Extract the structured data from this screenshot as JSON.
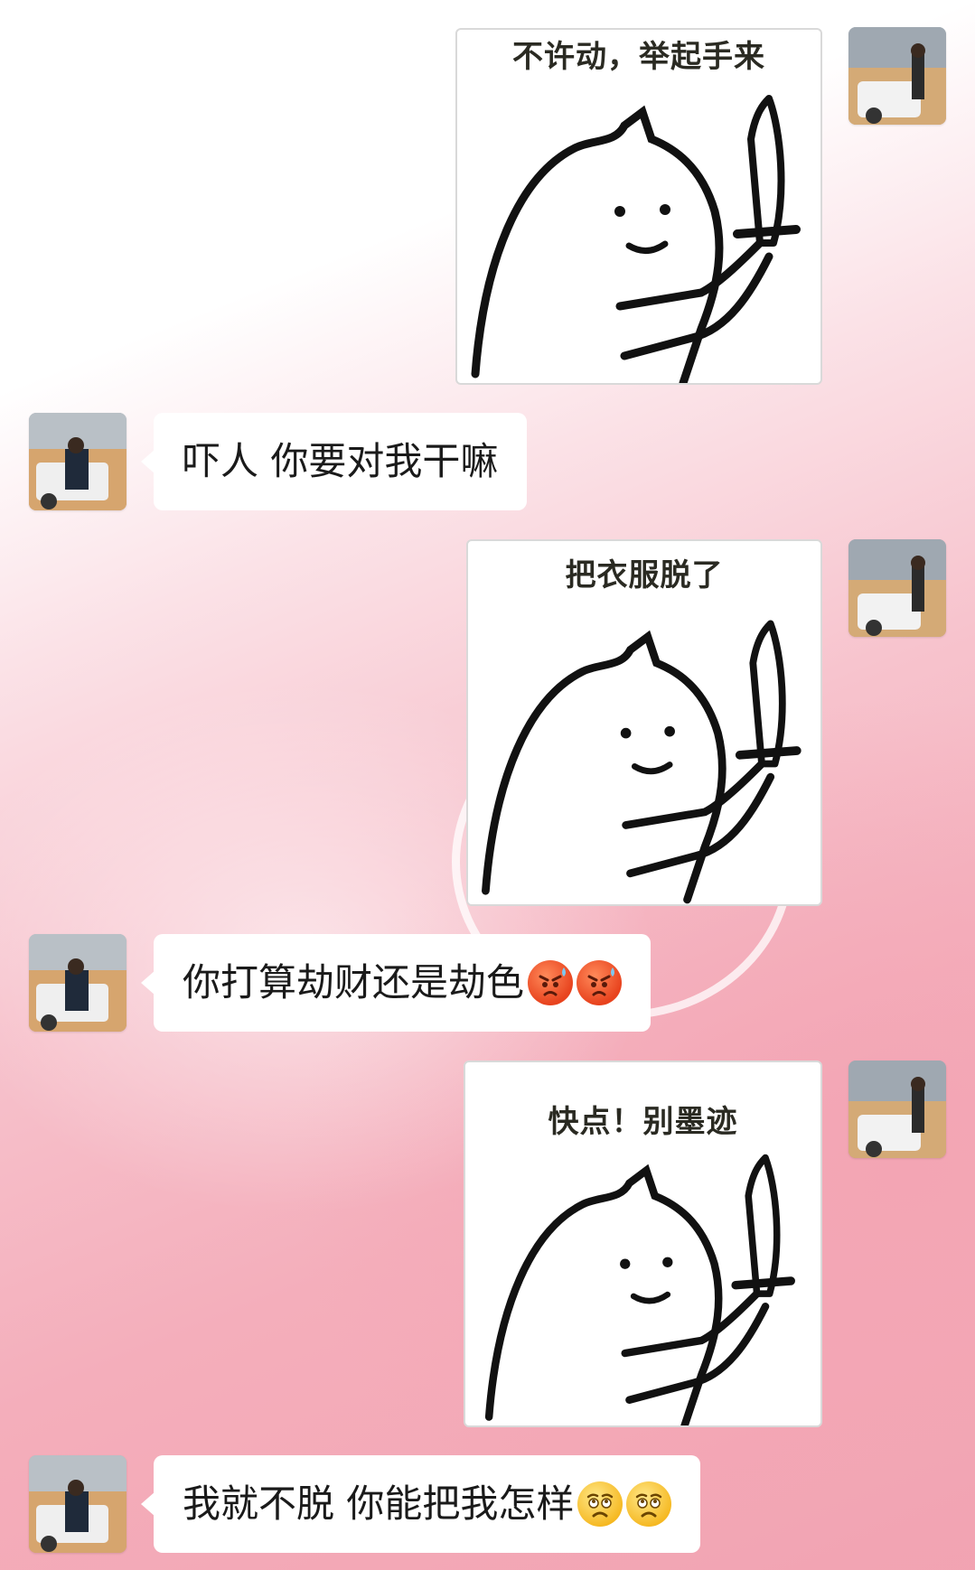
{
  "messages": [
    {
      "side": "right",
      "kind": "sticker",
      "caption": "不许动，举起手来"
    },
    {
      "side": "left",
      "kind": "text",
      "text": "吓人  你要对我干嘛",
      "emojis": []
    },
    {
      "side": "right",
      "kind": "sticker",
      "caption": "把衣服脱了"
    },
    {
      "side": "left",
      "kind": "text",
      "text": "你打算劫财还是劫色",
      "emojis": [
        "angry-sweat-emoji",
        "angry-sweat-emoji"
      ]
    },
    {
      "side": "right",
      "kind": "sticker",
      "caption": "快点！别墨迹"
    },
    {
      "side": "left",
      "kind": "text",
      "text": "我就不脱  你能把我怎样",
      "emojis": [
        "worried-emoji",
        "worried-emoji"
      ]
    }
  ],
  "colors": {
    "bubble": "#ffffff",
    "text": "#1a1a1a",
    "background_pink": "#f2a3b2"
  }
}
